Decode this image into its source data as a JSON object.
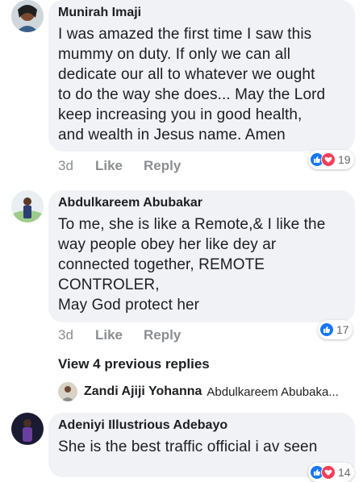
{
  "comments": [
    {
      "author": "Munirah Imaji",
      "lines": [
        "I was amazed the first time I saw this",
        "mummy on duty. If only we can all",
        "dedicate our all to whatever we ought",
        "to do the way she does... May the Lord",
        "keep increasing you in good health,",
        "and wealth in Jesus name. Amen"
      ],
      "time": "3d",
      "like_label": "Like",
      "reply_label": "Reply",
      "reactions": [
        "like",
        "love"
      ],
      "reaction_count": "19"
    },
    {
      "author": "Abdulkareem Abubakar",
      "lines": [
        "To me, she is like a Remote,& I like the",
        "way people obey her like dey ar",
        "connected together, REMOTE",
        "CONTROLER,",
        "May God protect her"
      ],
      "time": "3d",
      "like_label": "Like",
      "reply_label": "Reply",
      "reactions": [
        "like"
      ],
      "reaction_count": "17"
    },
    {
      "author": "Adeniyi Illustrious Adebayo",
      "lines": [
        "She is the best traffic official i av seen"
      ],
      "reactions": [
        "like",
        "love"
      ],
      "reaction_count": "14"
    }
  ],
  "view_replies": "View 4 previous replies",
  "reply_preview": {
    "author": "Zandi Ajiji Yohanna",
    "snippet": "Abdulkareem Abubaka..."
  },
  "colors": {
    "bubble": "#f0f2f5",
    "like_blue": "#1877f2",
    "love_red": "#f33e58",
    "meta_gray": "#8a8d91"
  }
}
